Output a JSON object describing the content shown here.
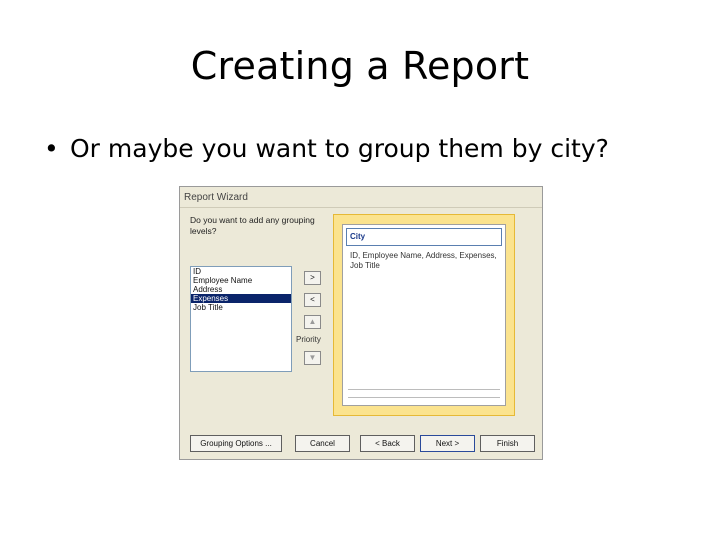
{
  "slide": {
    "title": "Creating a Report",
    "bullet_glyph": "•",
    "bullet": "Or maybe you want to group them by city?"
  },
  "wizard": {
    "title": "Report Wizard",
    "question": "Do you want to add any grouping levels?",
    "fields": [
      "ID",
      "Employee Name",
      "Address",
      "Expenses",
      "Job Title"
    ],
    "selected_field_index": 3,
    "buttons": {
      "add": ">",
      "remove": "<",
      "priority_up": "▲",
      "priority_down": "▼"
    },
    "priority_label": "Priority",
    "preview": {
      "group_field": "City",
      "detail_fields": "ID, Employee Name, Address, Expenses, Job Title"
    },
    "footer": {
      "grouping_options": "Grouping Options ...",
      "cancel": "Cancel",
      "back": "< Back",
      "next": "Next >",
      "finish": "Finish"
    }
  }
}
